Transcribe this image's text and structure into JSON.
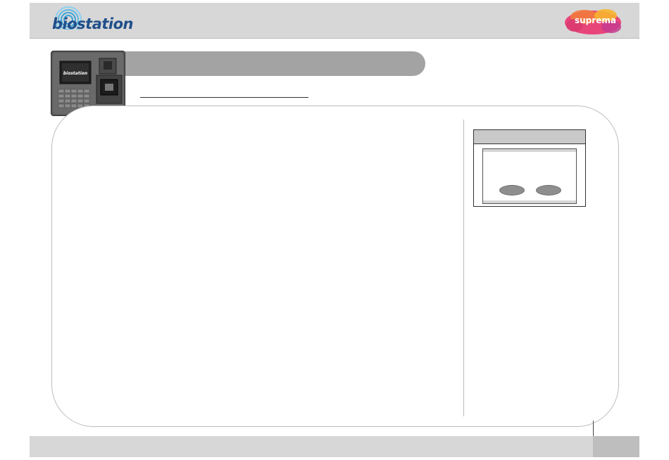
{
  "header": {
    "brand_logo_text": "biostation",
    "company_logo_text": "suprema"
  },
  "device_thumbnail": {
    "screen_logo_text": "biostation",
    "keypad_keys": [
      "1",
      "2",
      "3",
      "4",
      "5",
      "F1",
      "6",
      "7",
      "8",
      "9",
      "0",
      "F2",
      "ESC",
      "",
      "",
      "",
      "OK",
      "F3"
    ]
  },
  "colors": {
    "header_band": "#d7d7d7",
    "brand_blue": "#1f4f8b",
    "title_pill": "#a3a3a3",
    "frame_border": "#bdbdbd",
    "dialog_button": "#8e8e8e",
    "footer_band": "#d7d7d7",
    "company_accent": "#e8457a"
  },
  "icons": {
    "brand_swirl": "fingerprint-swirl-icon",
    "company_blob": "company-blob-icon",
    "fingerprint_sensor": "fingerprint-sensor-icon",
    "camera": "camera-icon"
  }
}
